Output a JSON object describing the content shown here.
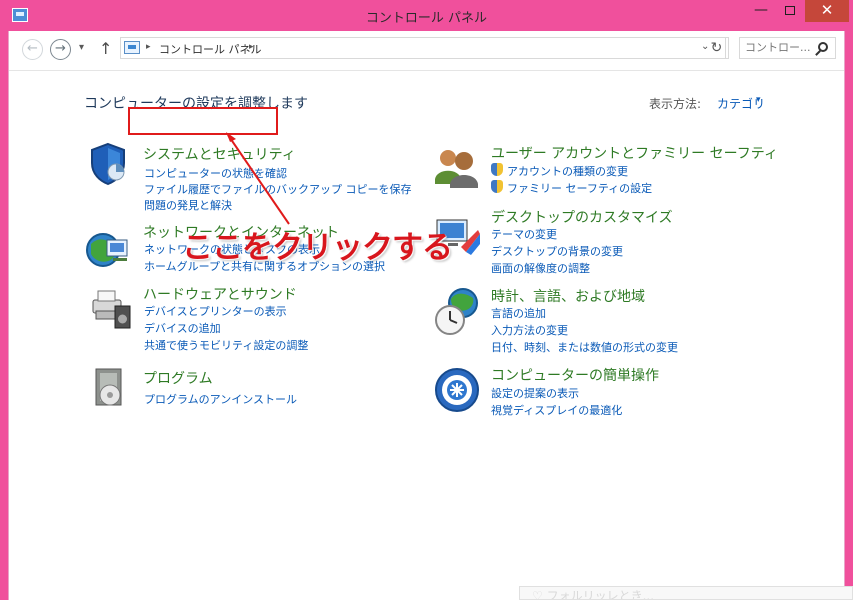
{
  "window": {
    "title": "コントロール パネル",
    "minimize": "—",
    "close": "✕"
  },
  "toolbar": {
    "back_icon": "←",
    "forward_icon": "→",
    "history_icon": "▾",
    "up_icon": "↑",
    "breadcrumb": "コントロール パネル",
    "breadcrumb_separator": "▸",
    "dropdown_icon": "⌄",
    "refresh_icon": "↻",
    "search_placeholder": "コントロー..."
  },
  "main": {
    "heading": "コンピューターの設定を調整します",
    "view_label": "表示方法:",
    "view_value": "カテゴリ",
    "view_caret": "▾"
  },
  "categories": [
    {
      "title": "システムとセキュリティ",
      "links": [
        "コンピューターの状態を確認",
        "ファイル履歴でファイルのバックアップ コピーを保存",
        "問題の発見と解決"
      ]
    },
    {
      "title": "ネットワークとインターネット",
      "links": [
        "ネットワークの状態とタスクの表示",
        "ホームグループと共有に関するオプションの選択"
      ]
    },
    {
      "title": "ハードウェアとサウンド",
      "links": [
        "デバイスとプリンターの表示",
        "デバイスの追加",
        "共通で使うモビリティ設定の調整"
      ]
    },
    {
      "title": "プログラム",
      "links": [
        "プログラムのアンインストール"
      ]
    },
    {
      "title": "ユーザー アカウントとファミリー セーフティ",
      "links": [
        "アカウントの種類の変更",
        "ファミリー セーフティの設定"
      ]
    },
    {
      "title": "デスクトップのカスタマイズ",
      "links": [
        "テーマの変更",
        "デスクトップの背景の変更",
        "画面の解像度の調整"
      ]
    },
    {
      "title": "時計、言語、および地域",
      "links": [
        "言語の追加",
        "入力方法の変更",
        "日付、時刻、または数値の形式の変更"
      ]
    },
    {
      "title": "コンピューターの簡単操作",
      "links": [
        "設定の提案の表示",
        "視覚ディスプレイの最適化"
      ]
    }
  ],
  "annotation": {
    "text": "ここをクリックする",
    "color": "#d8161d"
  },
  "colors": {
    "window_frame": "#f0509c",
    "close_button": "#c5473a",
    "link": "#0a5ab7",
    "category_title": "#2e7a24"
  },
  "bottom_peek": {
    "text": "♡ フォルリッレとき..."
  }
}
